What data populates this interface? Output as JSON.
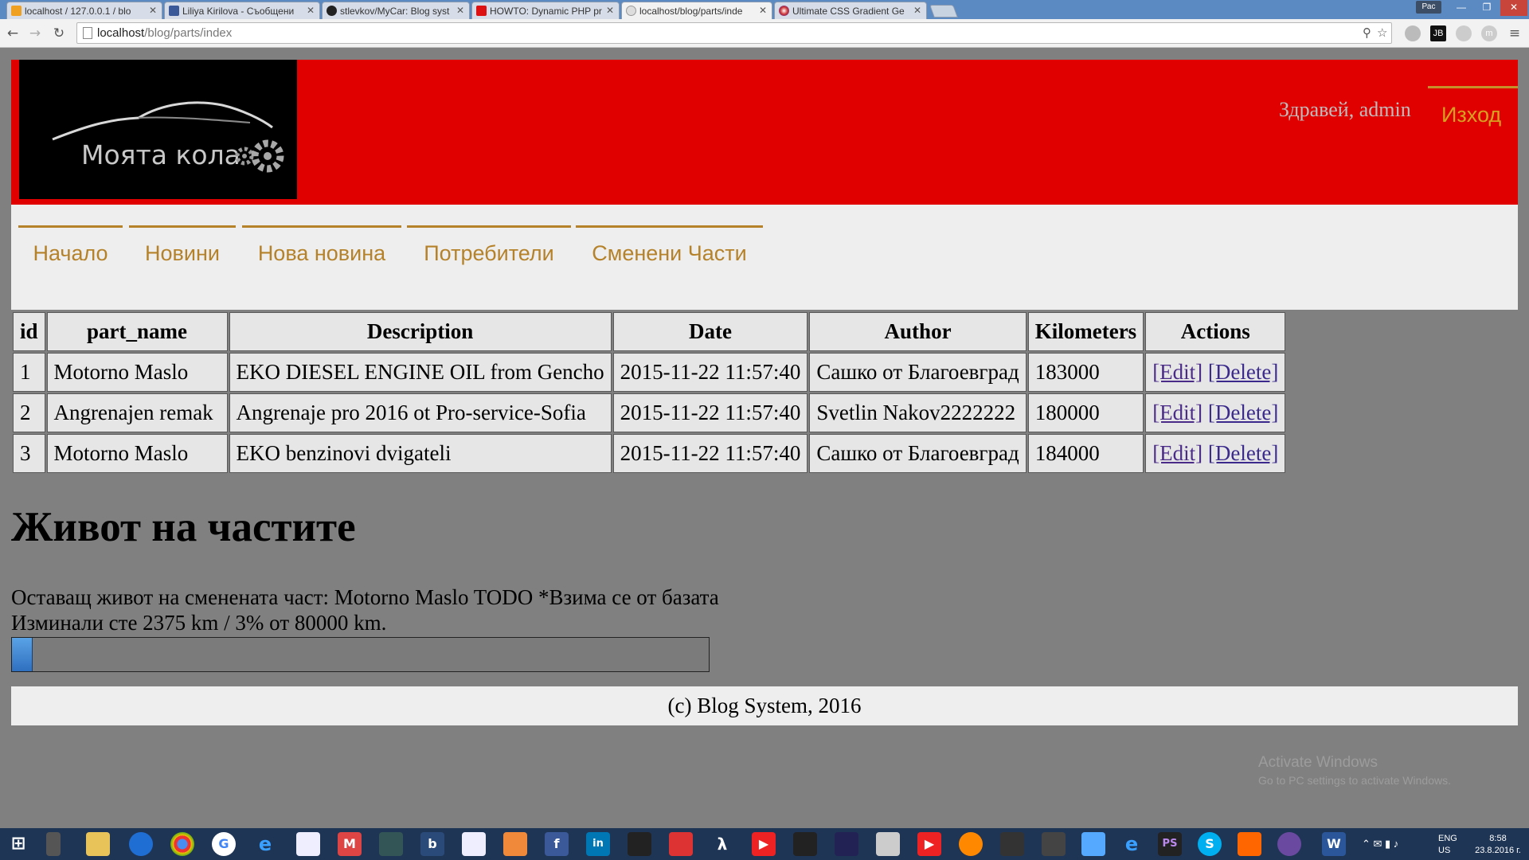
{
  "browser": {
    "tabs": [
      {
        "label": "localhost / 127.0.0.1 / blo",
        "fav_color": "#f0a020"
      },
      {
        "label": "Liliya Kirilova - Съобщени",
        "fav_color": "#3b5998"
      },
      {
        "label": "stlevkov/MyCar: Blog syst",
        "fav_color": "#222222"
      },
      {
        "label": "HOWTO: Dynamic PHP pr",
        "fav_color": "#d11"
      },
      {
        "label": "localhost/blog/parts/inde",
        "fav_color": "#bbbbbb"
      },
      {
        "label": "Ultimate CSS Gradient Ge",
        "fav_color": "#7a7a7a"
      }
    ],
    "user_badge": "Рас",
    "url_host": "localhost",
    "url_path": "/blog/parts/index"
  },
  "header": {
    "logo_text": "Моята кола",
    "greeting": "Здравей, admin",
    "logout": "Изход"
  },
  "nav": [
    {
      "label": "Начало"
    },
    {
      "label": "Новини"
    },
    {
      "label": "Нова новина"
    },
    {
      "label": "Потребители"
    },
    {
      "label": "Сменени Части"
    }
  ],
  "table": {
    "headers": [
      "id",
      "part_name",
      "Description",
      "Date",
      "Author",
      "Kilometers",
      "Actions"
    ],
    "edit_label": "[Edit]",
    "delete_label": "[Delete]",
    "rows": [
      {
        "id": "1",
        "part_name": "Motorno Maslo",
        "description": "EKO DIESEL ENGINE OIL from Gencho",
        "date": "2015-11-22 11:57:40",
        "author": "Сашко от Благоевград",
        "km": "183000"
      },
      {
        "id": "2",
        "part_name": "Angrenajen remak",
        "description": "Angrenaje pro 2016 ot Pro-service-Sofia",
        "date": "2015-11-22 11:57:40",
        "author": "Svetlin Nakov2222222",
        "km": "180000"
      },
      {
        "id": "3",
        "part_name": "Motorno Maslo",
        "description": "EKO benzinovi dvigateli",
        "date": "2015-11-22 11:57:40",
        "author": "Сашко от Благоевград",
        "km": "184000"
      }
    ]
  },
  "life": {
    "title": "Живот на частите",
    "line1": "Оставащ живот на сменената част: Motorno Maslo TODO *Взима се от базата",
    "line2": "Изминали сте 2375 km / 3% от 80000 km.",
    "progress_percent": 3
  },
  "footer": "(c) Blog System, 2016",
  "watermark": {
    "line1": "Activate Windows",
    "line2": "Go to PC settings to activate Windows."
  },
  "taskbar": {
    "lang": "ENG",
    "layout": "US",
    "time": "8:58",
    "date": "23.8.2016 г."
  },
  "colors": {
    "header_bg": "#e10000",
    "nav_accent": "#b5822a",
    "page_bg": "#808080"
  }
}
